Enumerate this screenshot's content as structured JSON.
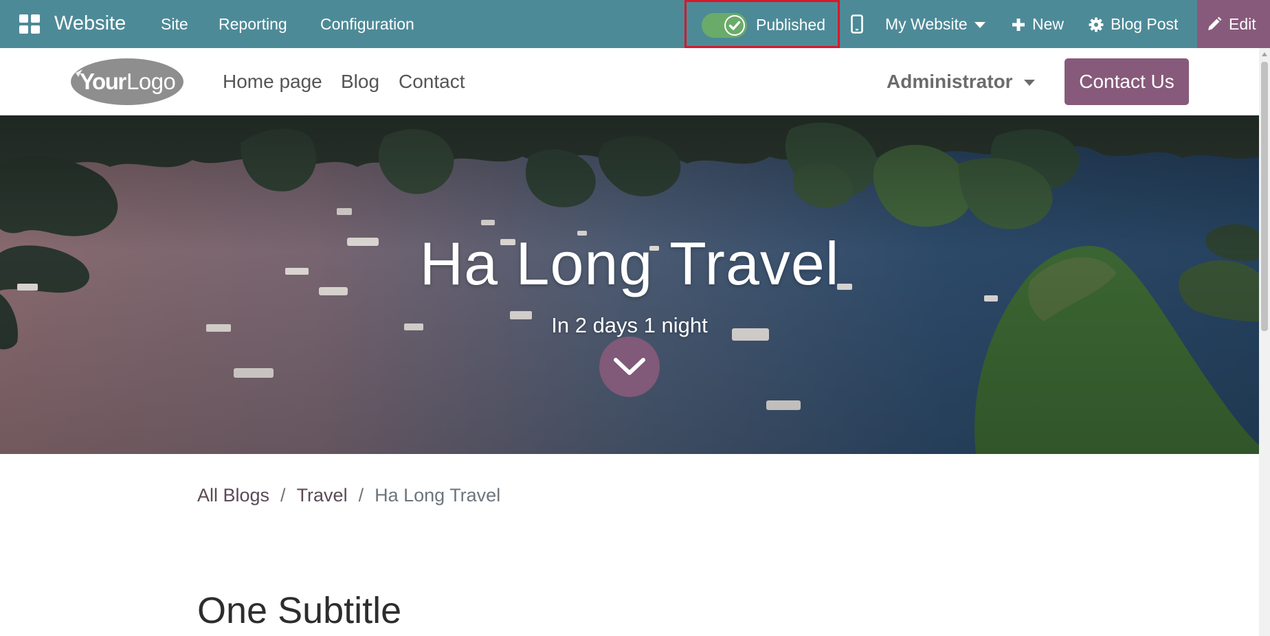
{
  "topbar": {
    "app_title": "Website",
    "menus": [
      "Site",
      "Reporting",
      "Configuration"
    ],
    "publish": {
      "label": "Published",
      "state": "on"
    },
    "website_switcher": "My Website",
    "new_label": "New",
    "blog_post_label": "Blog Post",
    "edit_label": "Edit",
    "colors": {
      "bar": "#4d8a97",
      "edit": "#875a7b",
      "toggle_on": "#6aab6a",
      "highlight": "#d7182a"
    }
  },
  "site_header": {
    "logo_text": "YourLogo",
    "nav": [
      "Home page",
      "Blog",
      "Contact"
    ],
    "user_menu": "Administrator",
    "cta": "Contact Us"
  },
  "hero": {
    "title": "Ha Long Travel",
    "subtitle": "In 2 days 1 night",
    "icon": "chevron-down-icon"
  },
  "breadcrumb": {
    "items": [
      "All Blogs",
      "Travel"
    ],
    "current": "Ha Long Travel"
  },
  "content": {
    "subtitle": "One Subtitle"
  }
}
